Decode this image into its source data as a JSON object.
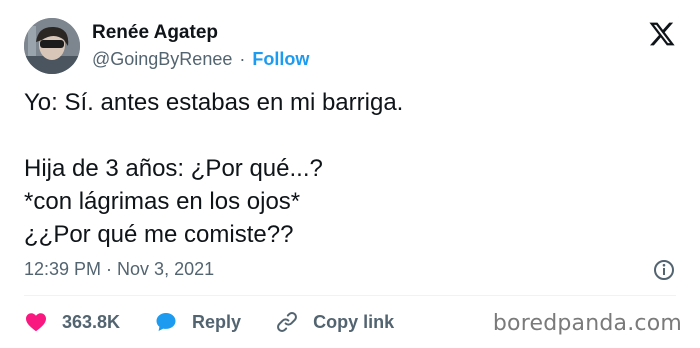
{
  "author": {
    "name": "Renée Agatep",
    "handle": "@GoingByRenee",
    "separator": "·",
    "follow_label": "Follow"
  },
  "tweet": {
    "lines": [
      "Yo: Sí. antes estabas en mi barriga.",
      "",
      "Hija de 3 años: ¿Por qué...?",
      "*con lágrimas en los ojos*",
      "¿¿Por qué me comiste??"
    ],
    "timestamp": "12:39 PM · Nov 3, 2021"
  },
  "actions": {
    "likes_count": "363.8K",
    "reply_label": "Reply",
    "copy_link_label": "Copy link"
  },
  "icons": {
    "brand": "x-logo-icon",
    "info": "info-icon",
    "like": "heart-icon",
    "reply": "speech-bubble-icon",
    "copy": "link-icon"
  },
  "colors": {
    "accent": "#1d9bf0",
    "heart": "#f91880",
    "muted": "#536471",
    "text": "#0f1419"
  },
  "watermark": "boredpanda.com"
}
